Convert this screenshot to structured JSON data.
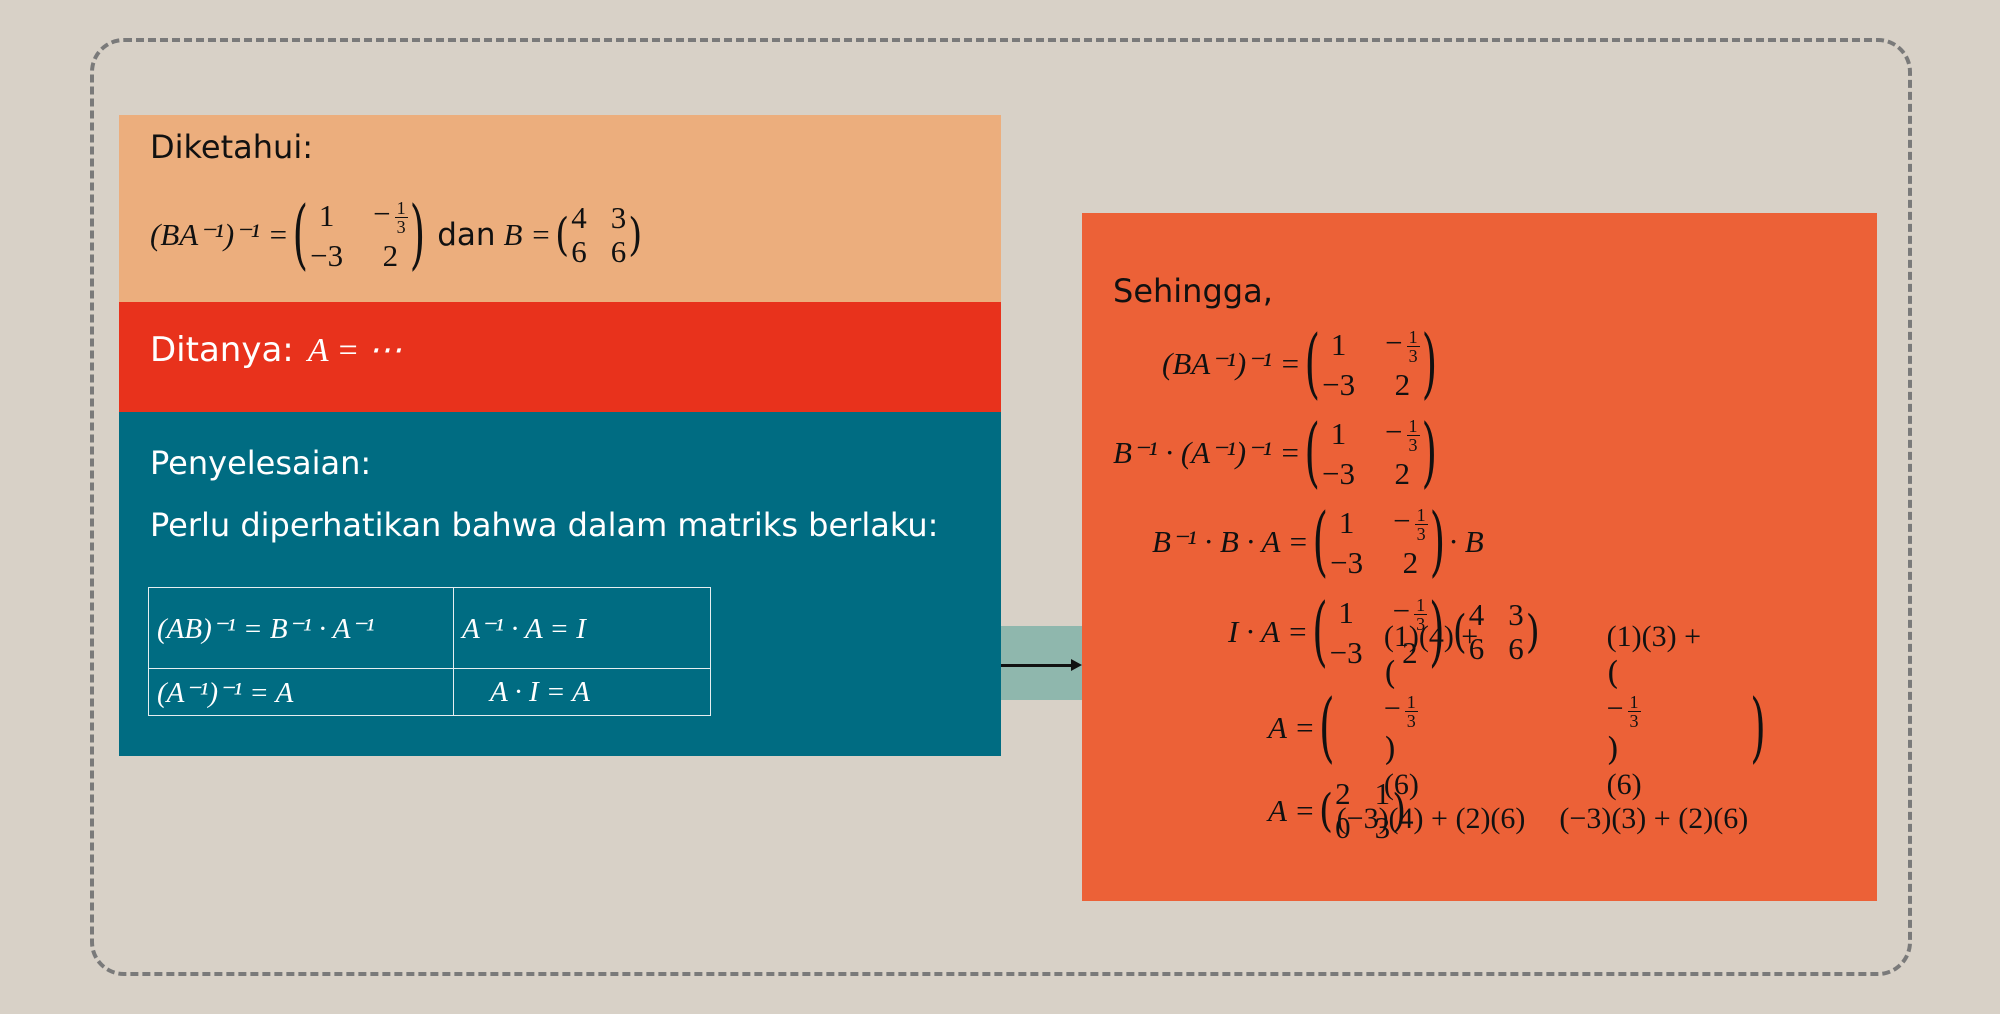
{
  "known": {
    "heading": "Diketahui:",
    "lhs": "(BA⁻¹)⁻¹ =",
    "matrix_lhs": [
      [
        "1",
        "−⅓"
      ],
      [
        "−3",
        "2"
      ]
    ],
    "conj": "dan",
    "b_label": "B =",
    "matrix_b": [
      [
        "4",
        "3"
      ],
      [
        "6",
        "6"
      ]
    ]
  },
  "asked": {
    "heading": "Ditanya:",
    "expr": "A = ⋯"
  },
  "solve": {
    "heading": "Penyelesaian:",
    "note": "Perlu diperhatikan bahwa dalam matriks berlaku:",
    "rules": [
      [
        "(AB)⁻¹ = B⁻¹ · A⁻¹",
        "A⁻¹ · A = I"
      ],
      [
        "(A⁻¹)⁻¹ = A",
        "A · I = A"
      ]
    ]
  },
  "result": {
    "heading": "Sehingga,",
    "steps": [
      {
        "lhs": "(BA⁻¹)⁻¹ =",
        "suffix": ""
      },
      {
        "lhs": "B⁻¹ · (A⁻¹)⁻¹ =",
        "suffix": ""
      },
      {
        "lhs": "B⁻¹ · B · A =",
        "suffix": "· B"
      },
      {
        "lhs": "I · A =",
        "suffix": ""
      },
      {
        "lhs": "A =",
        "suffix": ""
      },
      {
        "lhs": "A =",
        "suffix": ""
      }
    ],
    "expanded": [
      [
        "(1)(4) + ",
        "(6)",
        "(1)(3) + ",
        "(6)"
      ],
      [
        "(−3)(4) + (2)(6)",
        "(−3)(3) + (2)(6)"
      ]
    ],
    "final_matrix": [
      [
        "2",
        "1"
      ],
      [
        "0",
        "3"
      ]
    ]
  }
}
